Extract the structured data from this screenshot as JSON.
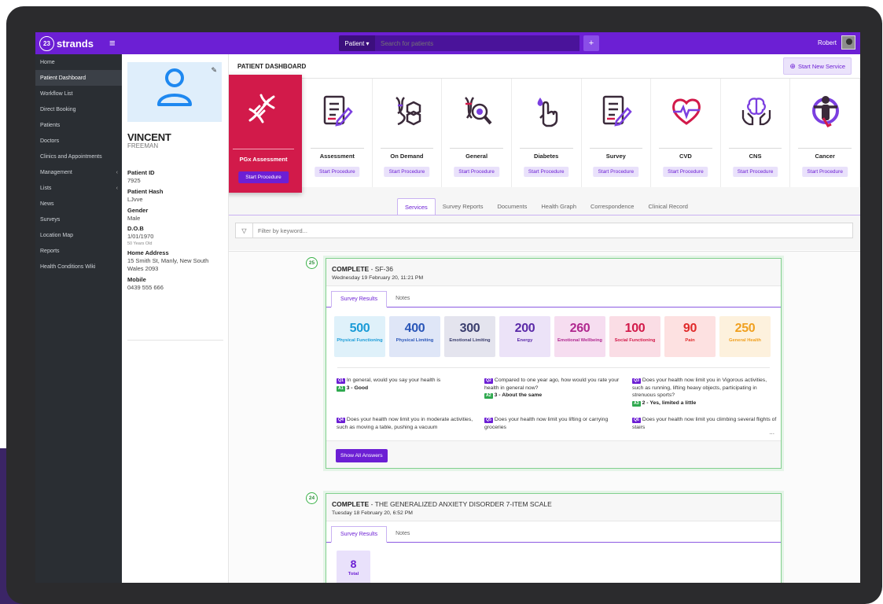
{
  "topbar": {
    "logo_text": "strands",
    "logo_badge": "23",
    "patient_dropdown": "Patient ▾",
    "search_placeholder": "Search for patients",
    "plus": "+",
    "user_name": "Robert"
  },
  "sidebar": {
    "items": [
      {
        "label": "Home",
        "chev": ""
      },
      {
        "label": "Patient Dashboard",
        "chev": ""
      },
      {
        "label": "Workflow List",
        "chev": ""
      },
      {
        "label": "Direct Booking",
        "chev": ""
      },
      {
        "label": "Patients",
        "chev": ""
      },
      {
        "label": "Doctors",
        "chev": ""
      },
      {
        "label": "Clinics and Appointments",
        "chev": ""
      },
      {
        "label": "Management",
        "chev": "‹"
      },
      {
        "label": "Lists",
        "chev": "‹"
      },
      {
        "label": "News",
        "chev": ""
      },
      {
        "label": "Surveys",
        "chev": ""
      },
      {
        "label": "Location Map",
        "chev": ""
      },
      {
        "label": "Reports",
        "chev": ""
      },
      {
        "label": "Health Conditions Wiki",
        "chev": ""
      }
    ],
    "active_index": 1
  },
  "profile": {
    "first_name": "VINCENT",
    "last_name": "FREEMAN",
    "patient_id_label": "Patient ID",
    "patient_id": "7925",
    "hash_label": "Patient Hash",
    "hash": "LJvve",
    "gender_label": "Gender",
    "gender": "Male",
    "dob_label": "D.O.B",
    "dob": "1/01/1970",
    "age": "50 Years Old",
    "address_label": "Home Address",
    "address": "15 Smith St, Manly, New South Wales 2093",
    "mobile_label": "Mobile",
    "mobile": "0439 555 666"
  },
  "dashboard": {
    "title": "PATIENT DASHBOARD",
    "new_service": "Start New Service",
    "start_label": "Start Procedure",
    "services": [
      {
        "name": "PGx Assessment",
        "icon": "dna-icon"
      },
      {
        "name": "Assessment",
        "icon": "form-icon"
      },
      {
        "name": "On Demand",
        "icon": "molecule-icon"
      },
      {
        "name": "General",
        "icon": "dna-search-icon"
      },
      {
        "name": "Diabetes",
        "icon": "finger-blood-icon"
      },
      {
        "name": "Survey",
        "icon": "form-icon"
      },
      {
        "name": "CVD",
        "icon": "heart-pulse-icon"
      },
      {
        "name": "CNS",
        "icon": "brain-hands-icon"
      },
      {
        "name": "Cancer",
        "icon": "ribbon-person-icon"
      }
    ]
  },
  "tabs": [
    "Services",
    "Survey Reports",
    "Documents",
    "Health Graph",
    "Correspondence",
    "Clinical Record"
  ],
  "filter": {
    "placeholder": "Filter by keyword..."
  },
  "feed": {
    "card1": {
      "num": "25",
      "status": "COMPLETE",
      "name": " - SF-36",
      "date": "Wednesday 19 February 20, 11:21 PM",
      "tab_results": "Survey Results",
      "tab_notes": "Notes",
      "scores": [
        {
          "value": "500",
          "label": "Physical Functioning",
          "bg": "#dff1fa",
          "color": "#1a9bd7"
        },
        {
          "value": "400",
          "label": "Physical Limiting",
          "bg": "#dfe6f7",
          "color": "#2a56b8"
        },
        {
          "value": "300",
          "label": "Emotional Limiting",
          "bg": "#e4e4ee",
          "color": "#3b3f6e"
        },
        {
          "value": "200",
          "label": "Energy",
          "bg": "#ece3f8",
          "color": "#5b2aa8"
        },
        {
          "value": "260",
          "label": "Emotional Wellbeing",
          "bg": "#f6ddf0",
          "color": "#b0288f"
        },
        {
          "value": "100",
          "label": "Social Functioning",
          "bg": "#fadde5",
          "color": "#d21a4a"
        },
        {
          "value": "90",
          "label": "Pain",
          "bg": "#fde1e1",
          "color": "#e02a2a"
        },
        {
          "value": "250",
          "label": "General Health",
          "bg": "#fdf1dd",
          "color": "#f0a020"
        }
      ],
      "qa": [
        {
          "q": "Q1",
          "text": "In general, would you say your health is",
          "a": "A1",
          "answer": "3 - Good"
        },
        {
          "q": "Q2",
          "text": "Compared to one year ago, how would you rate your health in general now?",
          "a": "A2",
          "answer": "3 - About the same"
        },
        {
          "q": "Q3",
          "text": "Does your health now limit you in Vigorous activities, such as running, lifting heavy objects, participating in strenuous sports?",
          "a": "A3",
          "answer": "2 - Yes, limited a little"
        },
        {
          "q": "Q4",
          "text": "Does your health now limit you in moderate activities, such as moving a table, pushing a vacuum",
          "a": "",
          "answer": ""
        },
        {
          "q": "Q5",
          "text": "Does your health now limit you lifting or carrying groceries",
          "a": "",
          "answer": ""
        },
        {
          "q": "Q6",
          "text": "Does your health now limit you climbing several flights of stairs",
          "a": "",
          "answer": ""
        }
      ],
      "ellipsis": "...",
      "show_all": "Show All Answers"
    },
    "card2": {
      "num": "24",
      "status": "COMPLETE",
      "name": " - THE GENERALIZED ANXIETY DISORDER 7-ITEM SCALE",
      "date": "Tuesday 18 February 20, 6:52 PM",
      "tab_results": "Survey Results",
      "tab_notes": "Notes",
      "total_value": "8",
      "total_label": "Total"
    }
  },
  "colors": {
    "accent": "#6c1fd4",
    "feature": "#d21a4a",
    "complete": "#3cb24a",
    "sidebar": "#2a2e33"
  }
}
